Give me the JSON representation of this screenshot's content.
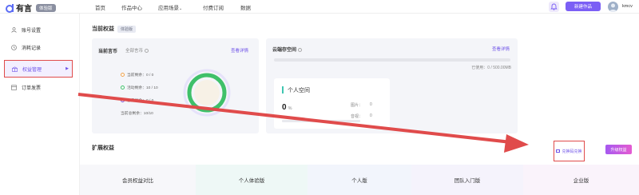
{
  "brand": {
    "name": "有言",
    "badge": "体验版"
  },
  "nav": {
    "home": "首页",
    "works": "作品中心",
    "apps": "应用场景",
    "pay": "付费订阅",
    "data": "数据"
  },
  "header": {
    "new_button": "新建作品",
    "username": "kmcv"
  },
  "sidebar": {
    "items": [
      {
        "label": "账号设置",
        "icon": "user-icon"
      },
      {
        "label": "消耗记录",
        "icon": "clock-icon"
      },
      {
        "label": "权益管理",
        "icon": "gift-icon"
      },
      {
        "label": "订单发票",
        "icon": "invoice-icon"
      }
    ]
  },
  "current": {
    "title": "当前权益",
    "badge": "体验版"
  },
  "coins": {
    "title": "当前言币",
    "sub": "全部言币",
    "link": "查看详情",
    "rows": [
      {
        "label": "当前剩余：0 / 0",
        "color": "#f0a24b"
      },
      {
        "label": "活动剩余：10 / 10",
        "color": "#3fc06a"
      },
      {
        "label": "套餐剩余：0 / 0",
        "color": "#7a4fd1"
      },
      {
        "label": "当前总剩余：10/10",
        "color": ""
      }
    ]
  },
  "storage": {
    "title": "云端存空间",
    "link": "查看详情",
    "used": "已使用：0 / 500.00MB",
    "progress": 0,
    "personal": {
      "title": "个人空间",
      "pct_value": "0",
      "pct_unit": "%",
      "stat1_label": "图片：",
      "stat1_value": "0",
      "stat2_label": "音视：",
      "stat2_value": "0"
    }
  },
  "extend": {
    "title": "扩展权益",
    "bind_button": "兑换码兑换",
    "upgrade_button": "升级权益"
  },
  "compare": {
    "columns": [
      "会员权益对比",
      "个人体验版",
      "个人版",
      "团队入门版",
      "企业版"
    ]
  },
  "colors": {
    "accent": "#7b5ff5",
    "annotation": "#e04b4b"
  }
}
